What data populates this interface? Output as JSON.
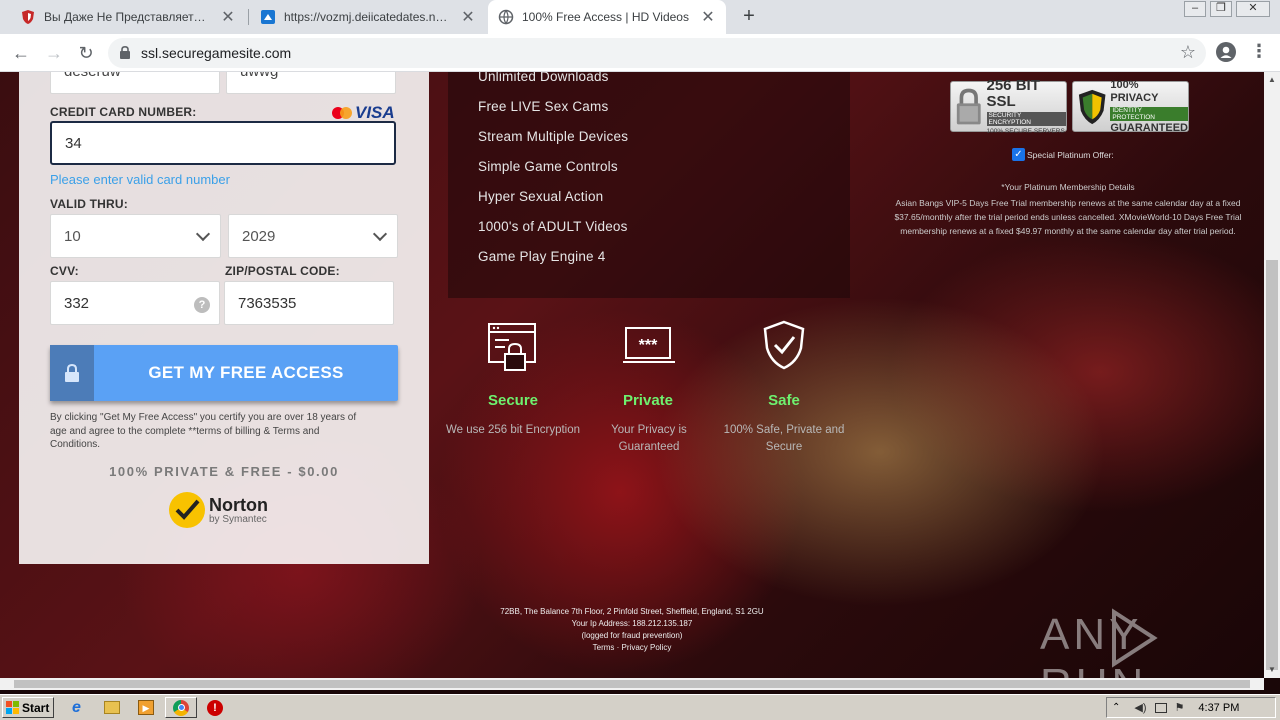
{
  "browser": {
    "tabs": [
      {
        "label": "Вы Даже Не Представляете Что М",
        "icon": "shield-icon"
      },
      {
        "label": "https://vozmj.deiicatedates.net/c/d",
        "icon": "site-icon"
      },
      {
        "label": "100% Free Access | HD Videos",
        "icon": "globe-icon"
      }
    ],
    "url": "ssl.securegamesite.com"
  },
  "form": {
    "prev_values": [
      "deseruw",
      "uwwg"
    ],
    "card_label": "CREDIT CARD NUMBER:",
    "card_brand": "VISA",
    "card_value": "34",
    "card_error": "Please enter valid card number",
    "valid_label": "VALID THRU:",
    "month": "10",
    "year": "2029",
    "cvv_label": "CVV:",
    "cvv_value": "332",
    "cvv_help": "?",
    "zip_label": "ZIP/POSTAL CODE:",
    "zip_value": "7363535",
    "cta": "GET MY FREE ACCESS",
    "disclaimer": "By clicking \"Get My Free Access\" you certify you are over 18 years of age and agree to the complete **terms of billing & Terms and Conditions.",
    "tagline": "100% PRIVATE & FREE - $0.00",
    "norton_name": "Norton",
    "norton_sub": "by Symantec"
  },
  "features": [
    "Unlimited Downloads",
    "Free LIVE Sex Cams",
    "Stream Multiple Devices",
    "Simple Game Controls",
    "Hyper Sexual Action",
    "1000's of ADULT Videos",
    "Game Play Engine 4"
  ],
  "badges": {
    "ssl_title": "256 BIT SSL",
    "ssl_line1": "SECURITY ENCRYPTION",
    "ssl_line2": "100% SECURE SERVERS",
    "privacy_title": "100% PRIVACY",
    "privacy_line1": "IDENTITY PROTECTION",
    "privacy_line2": "GUARANTEED"
  },
  "offer": {
    "checkbox_label": "Special Platinum Offer:",
    "details_title": "*Your Platinum Membership Details",
    "details_body": "Asian Bangs VIP-5 Days Free Trial membership renews at the same calendar day at a fixed $37.65/monthly after the trial period ends unless cancelled. XMovieWorld-10 Days Free Trial membership renews at a fixed $49.97 monthly at the same calendar day after trial period."
  },
  "trio": [
    {
      "title": "Secure",
      "text": "We use 256 bit Encryption",
      "icon": "browser-lock-icon"
    },
    {
      "title": "Private",
      "text": "Your Privacy is Guaranteed",
      "icon": "password-monitor-icon"
    },
    {
      "title": "Safe",
      "text": "100% Safe, Private and Secure",
      "icon": "shield-check-icon"
    }
  ],
  "footer": {
    "address": "72BB, The Balance 7th Floor, 2 Pinfold Street, Sheffield, England, S1 2GU",
    "ip": "Your Ip Address: 188.212.135.187",
    "logged": "(logged for fraud prevention)",
    "links": "Terms · Privacy Policy"
  },
  "watermark": "ANY RUN",
  "taskbar": {
    "start": "Start",
    "clock": "4:37 PM"
  }
}
